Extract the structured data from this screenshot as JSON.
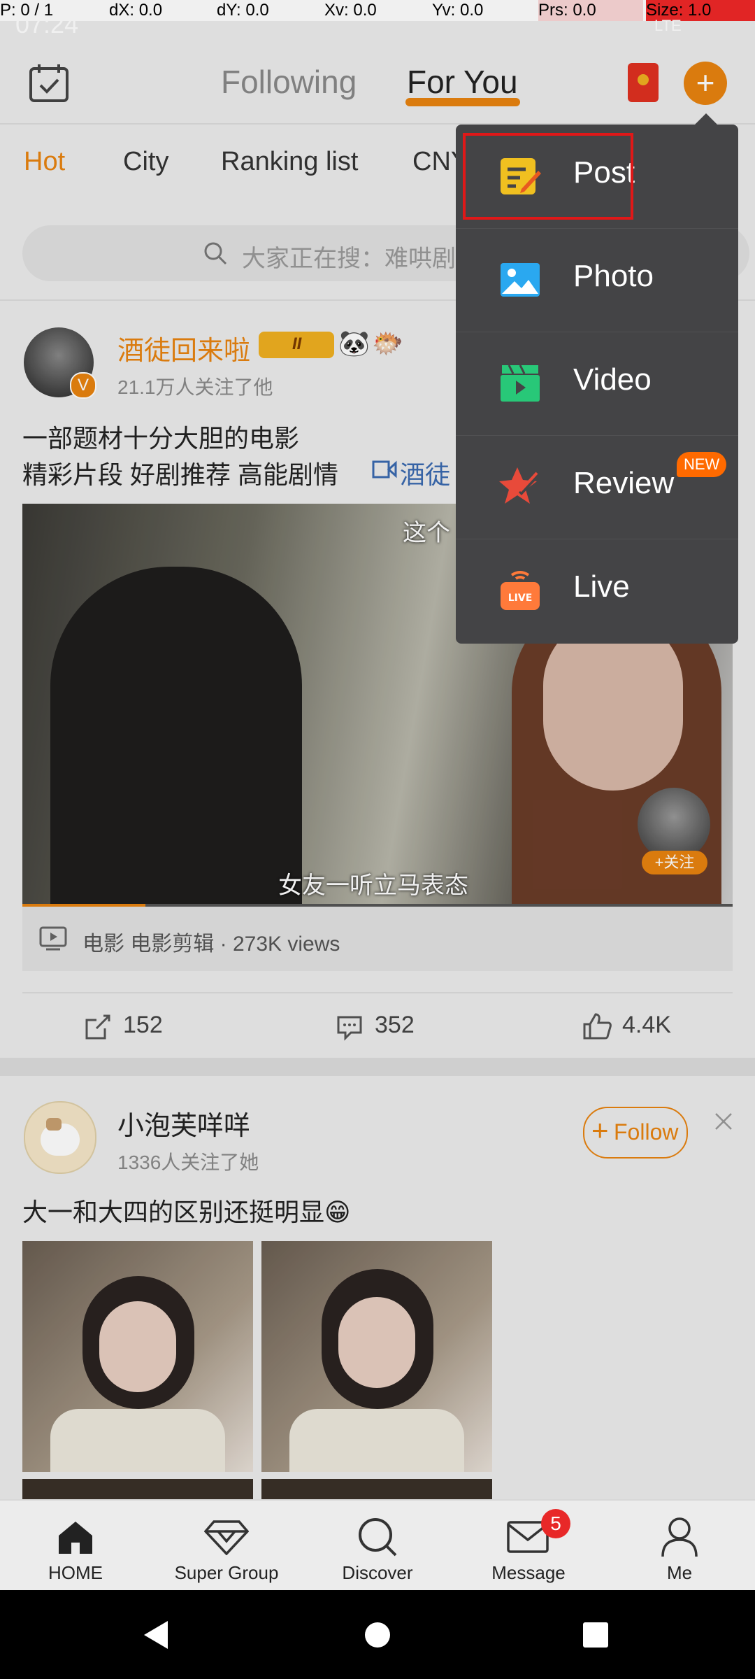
{
  "debug": {
    "p": "P: 0 / 1",
    "dx": "dX: 0.0",
    "dy": "dY: 0.0",
    "xv": "Xv: 0.0",
    "yv": "Yv: 0.0",
    "prs": "Prs: 0.0",
    "size": "Size: 1.0"
  },
  "status": {
    "time": "07:24",
    "network": "LTE"
  },
  "header": {
    "tab_following": "Following",
    "tab_foryou": "For You",
    "accent": "#e8830f"
  },
  "categories": [
    "Hot",
    "City",
    "Ranking list",
    "CNY"
  ],
  "search": {
    "placeholder": "大家正在搜：难哄剧"
  },
  "post1": {
    "author": "酒徒回来啦",
    "level": "II",
    "followers": "21.1万人关注了他",
    "line1": "一部题材十分大胆的电影",
    "line2": "精彩片段 好剧推荐 高能剧情",
    "tag": "酒徒",
    "subtitle_top": "这个",
    "subtitle": "女友一听立马表态",
    "follow_small": "+关注",
    "meta": "电影 电影剪辑 · 273K views",
    "shares": "152",
    "comments": "352",
    "likes": "4.4K"
  },
  "post2": {
    "author": "小泡芙咩咩",
    "followers": "1336人关注了她",
    "text": "大一和大四的区别还挺明显😁",
    "follow": "Follow"
  },
  "menu": [
    {
      "label": "Post",
      "icon": "post-icon"
    },
    {
      "label": "Photo",
      "icon": "photo-icon"
    },
    {
      "label": "Video",
      "icon": "video-icon"
    },
    {
      "label": "Review",
      "icon": "review-icon",
      "badge": "NEW"
    },
    {
      "label": "Live",
      "icon": "live-icon"
    }
  ],
  "nav": [
    {
      "label": "HOME"
    },
    {
      "label": "Super Group"
    },
    {
      "label": "Discover"
    },
    {
      "label": "Message",
      "badge": "5"
    },
    {
      "label": "Me"
    }
  ]
}
